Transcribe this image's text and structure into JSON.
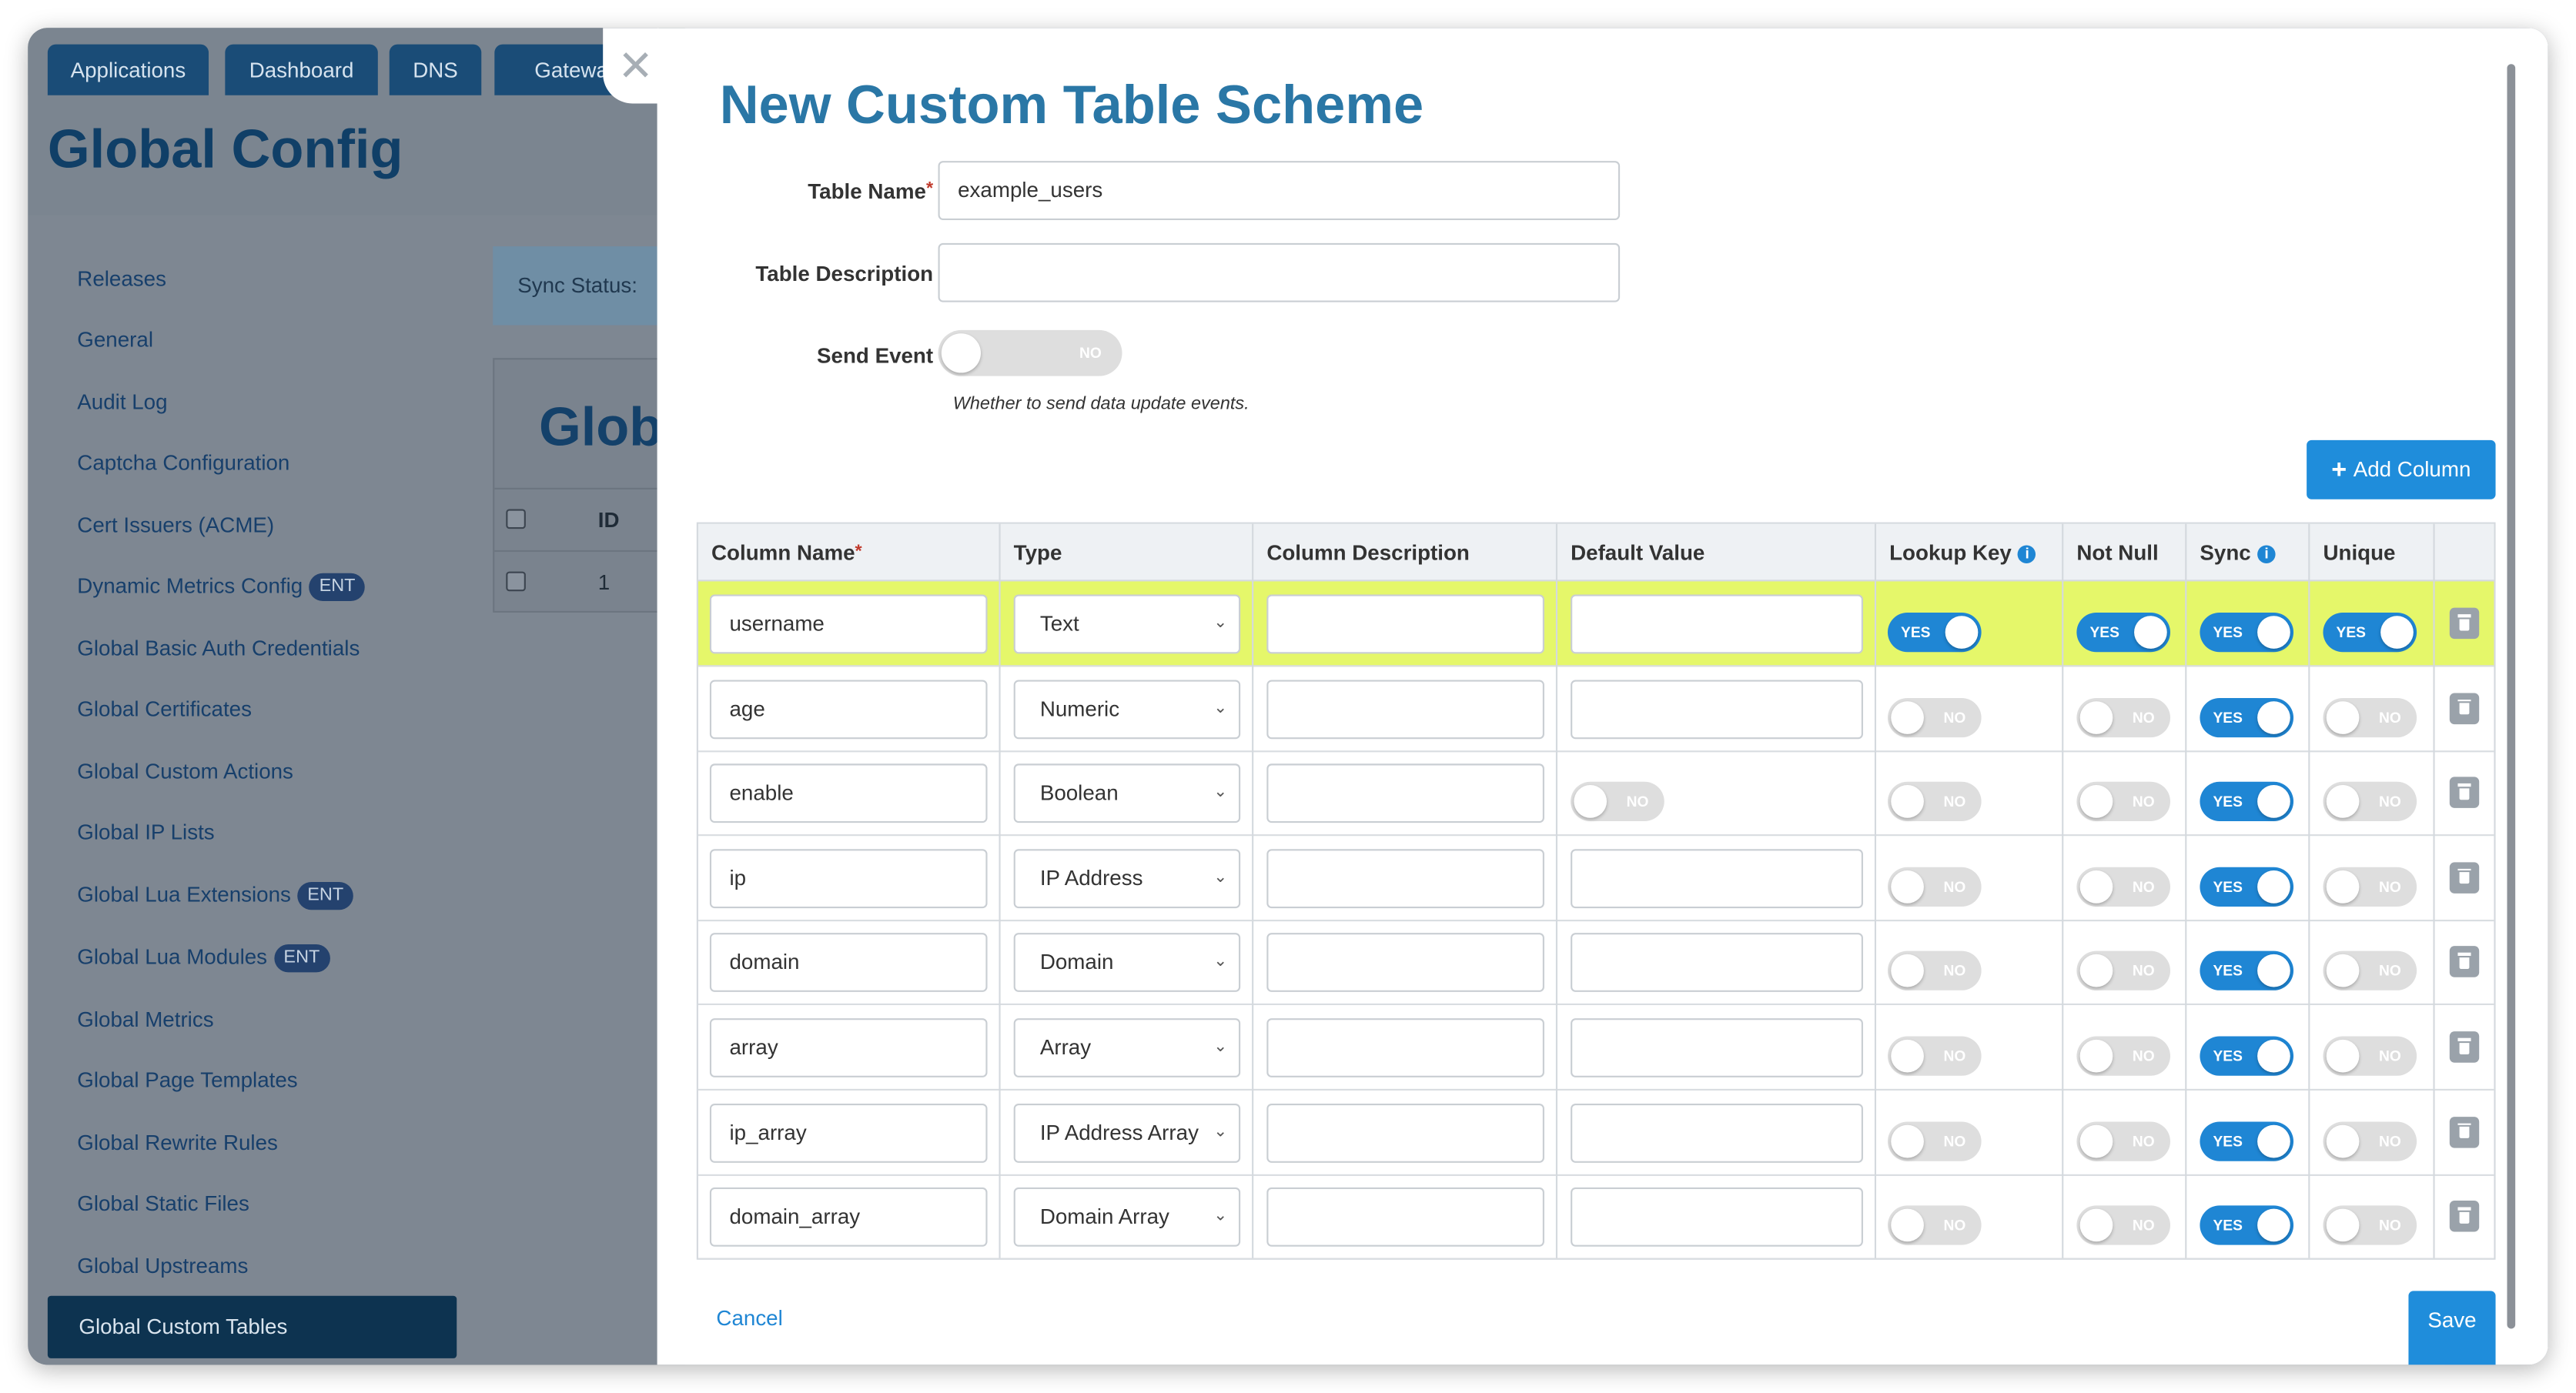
{
  "background": {
    "tabs": [
      "Applications",
      "Dashboard",
      "DNS",
      "Gateway"
    ],
    "page_title": "Global Config",
    "sidebar": {
      "items": [
        {
          "label": "Releases",
          "badge": ""
        },
        {
          "label": "General",
          "badge": ""
        },
        {
          "label": "Audit Log",
          "badge": ""
        },
        {
          "label": "Captcha Configuration",
          "badge": ""
        },
        {
          "label": "Cert Issuers (ACME)",
          "badge": ""
        },
        {
          "label": "Dynamic Metrics Config",
          "badge": "ENT"
        },
        {
          "label": "Global Basic Auth Credentials",
          "badge": ""
        },
        {
          "label": "Global Certificates",
          "badge": ""
        },
        {
          "label": "Global Custom Actions",
          "badge": ""
        },
        {
          "label": "Global IP Lists",
          "badge": ""
        },
        {
          "label": "Global Lua Extensions",
          "badge": "ENT"
        },
        {
          "label": "Global Lua Modules",
          "badge": "ENT"
        },
        {
          "label": "Global Metrics",
          "badge": ""
        },
        {
          "label": "Global Page Templates",
          "badge": ""
        },
        {
          "label": "Global Rewrite Rules",
          "badge": ""
        },
        {
          "label": "Global Static Files",
          "badge": ""
        },
        {
          "label": "Global Upstreams",
          "badge": ""
        }
      ],
      "active_label": "Global Custom Tables"
    },
    "sync_status_label": "Sync Status:",
    "panel_heading": "Glob",
    "table_id_header": "ID",
    "table_first_id": "1"
  },
  "modal": {
    "title": "New Custom Table Scheme",
    "fields": {
      "table_name_label": "Table Name",
      "table_name_value": "example_users",
      "table_description_label": "Table Description",
      "table_description_value": "",
      "send_event_label": "Send Event",
      "send_event_value": "NO",
      "send_event_hint": "Whether to send data update events."
    },
    "add_column_label": "Add Column",
    "columns_header": {
      "column_name": "Column Name",
      "type": "Type",
      "column_description": "Column Description",
      "default_value": "Default Value",
      "lookup_key": "Lookup Key",
      "not_null": "Not Null",
      "sync": "Sync",
      "unique": "Unique"
    },
    "yes_label": "YES",
    "no_label": "NO",
    "columns": [
      {
        "name": "username",
        "type": "Text",
        "default_toggle": false,
        "lookup_key": "YES",
        "not_null": "YES",
        "sync": "YES",
        "unique": "YES",
        "highlighted": true
      },
      {
        "name": "age",
        "type": "Numeric",
        "default_toggle": false,
        "lookup_key": "NO",
        "not_null": "NO",
        "sync": "YES",
        "unique": "NO",
        "highlighted": false
      },
      {
        "name": "enable",
        "type": "Boolean",
        "default_toggle": true,
        "default_value": "NO",
        "lookup_key": "NO",
        "not_null": "NO",
        "sync": "YES",
        "unique": "NO",
        "highlighted": false
      },
      {
        "name": "ip",
        "type": "IP Address",
        "default_toggle": false,
        "lookup_key": "NO",
        "not_null": "NO",
        "sync": "YES",
        "unique": "NO",
        "highlighted": false
      },
      {
        "name": "domain",
        "type": "Domain",
        "default_toggle": false,
        "lookup_key": "NO",
        "not_null": "NO",
        "sync": "YES",
        "unique": "NO",
        "highlighted": false
      },
      {
        "name": "array",
        "type": "Array",
        "default_toggle": false,
        "lookup_key": "NO",
        "not_null": "NO",
        "sync": "YES",
        "unique": "NO",
        "highlighted": false
      },
      {
        "name": "ip_array",
        "type": "IP Address Array",
        "default_toggle": false,
        "lookup_key": "NO",
        "not_null": "NO",
        "sync": "YES",
        "unique": "NO",
        "highlighted": false
      },
      {
        "name": "domain_array",
        "type": "Domain Array",
        "default_toggle": false,
        "lookup_key": "NO",
        "not_null": "NO",
        "sync": "YES",
        "unique": "NO",
        "highlighted": false
      }
    ],
    "cancel_label": "Cancel",
    "save_label": "Save"
  },
  "colors": {
    "accent": "#1f86d4",
    "title": "#2a77a6",
    "highlight_row": "#e5f76a",
    "navy": "#0d3350"
  },
  "icons": [
    "close-icon",
    "plus-icon",
    "info-icon",
    "chevron-down-icon",
    "trash-icon"
  ]
}
